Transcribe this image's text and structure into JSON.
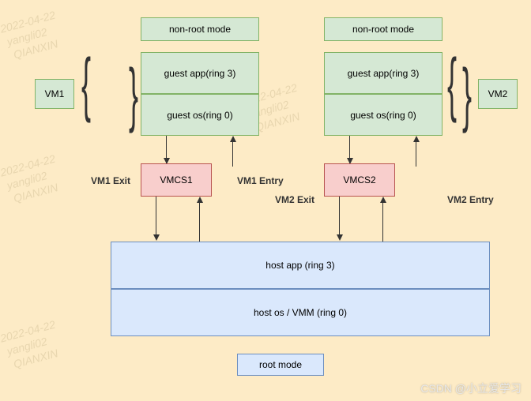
{
  "vm1": {
    "label": "VM1",
    "non_root": "non-root mode",
    "guest_app": "guest app(ring 3)",
    "guest_os": "guest os(ring 0)",
    "exit": "VM1 Exit",
    "entry": "VM1 Entry",
    "vmcs": "VMCS1"
  },
  "vm2": {
    "label": "VM2",
    "non_root": "non-root mode",
    "guest_app": "guest app(ring 3)",
    "guest_os": "guest os(ring 0)",
    "exit": "VM2 Exit",
    "entry": "VM2 Entry",
    "vmcs": "VMCS2"
  },
  "host": {
    "app": "host app (ring 3)",
    "os": "host os / VMM (ring 0)",
    "root": "root mode"
  },
  "watermark": "2022-04-22\n yangli02\n  QIANXIN",
  "credit": "CSDN @小立爱学习"
}
